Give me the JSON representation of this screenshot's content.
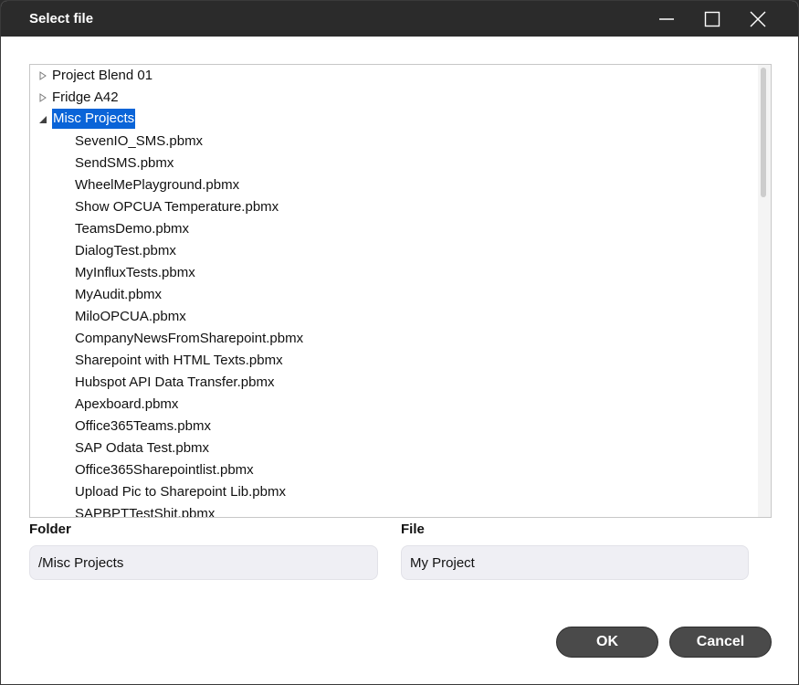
{
  "window": {
    "title": "Select file"
  },
  "tree": {
    "folders": [
      {
        "label": "Project Blend 01",
        "expanded": false
      },
      {
        "label": "Fridge A42",
        "expanded": false
      },
      {
        "label": "Misc Projects",
        "expanded": true,
        "selected": true
      }
    ],
    "files": [
      "SevenIO_SMS.pbmx",
      "SendSMS.pbmx",
      "WheelMePlayground.pbmx",
      "Show OPCUA Temperature.pbmx",
      "TeamsDemo.pbmx",
      "DialogTest.pbmx",
      "MyInfluxTests.pbmx",
      "MyAudit.pbmx",
      "MiloOPCUA.pbmx",
      "CompanyNewsFromSharepoint.pbmx",
      "Sharepoint with HTML Texts.pbmx",
      "Hubspot API Data Transfer.pbmx",
      "Apexboard.pbmx",
      "Office365Teams.pbmx",
      "SAP Odata Test.pbmx",
      "Office365Sharepointlist.pbmx",
      "Upload Pic to Sharepoint Lib.pbmx",
      "SAPBPTTestShit.pbmx"
    ]
  },
  "form": {
    "folder_label": "Folder",
    "folder_value": "/Misc Projects",
    "file_label": "File",
    "file_value": "My Project"
  },
  "buttons": {
    "ok": "OK",
    "cancel": "Cancel"
  },
  "colors": {
    "titlebar": "#2b2b2b",
    "selection": "#0a64d8",
    "button": "#4a4a4a"
  }
}
